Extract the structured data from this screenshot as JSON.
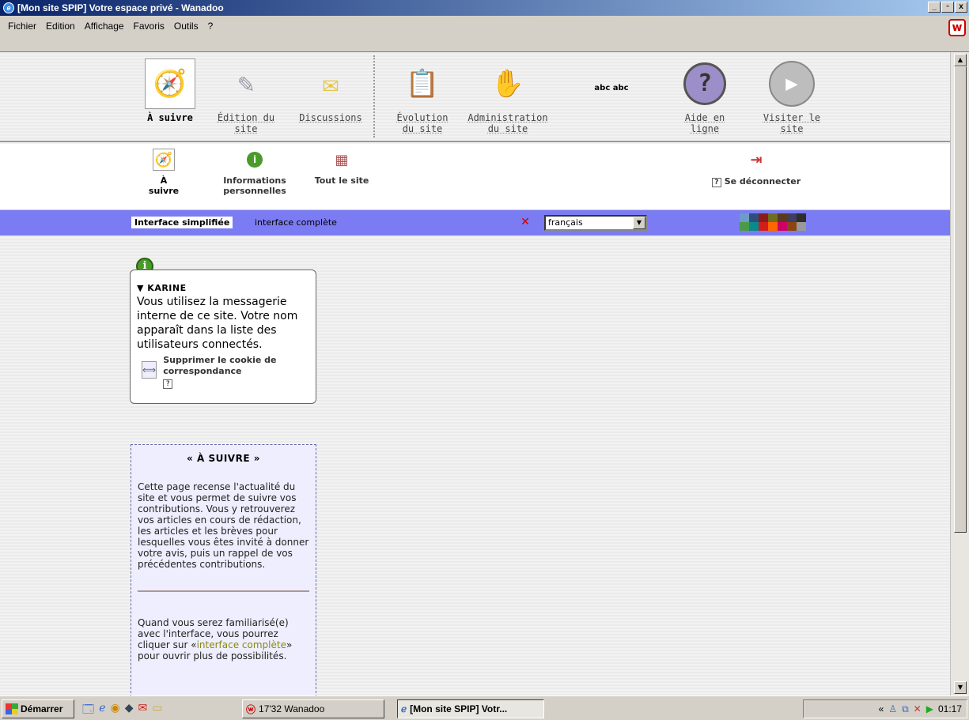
{
  "window": {
    "title": "[Mon site SPIP] Votre espace privé - Wanadoo",
    "controls": [
      "_",
      "▫",
      "x"
    ]
  },
  "menu": [
    "Fichier",
    "Edition",
    "Affichage",
    "Favoris",
    "Outils",
    "?"
  ],
  "topnav": [
    {
      "label": "À suivre",
      "icon": "compass-icon",
      "active": true
    },
    {
      "label": "Édition du site",
      "icon": "pens-icon"
    },
    {
      "label": "Discussions",
      "icon": "notes-icon"
    },
    {
      "label": "Évolution du site",
      "icon": "clipboard-icon"
    },
    {
      "label": "Administration du site",
      "icon": "admin-hand-icon"
    },
    {
      "label": "abc abc",
      "icon": "spelling-icon"
    },
    {
      "label": "Aide en ligne",
      "icon": "help-icon"
    },
    {
      "label": "Visiter le site",
      "icon": "play-icon"
    }
  ],
  "subnav": [
    {
      "label": "À suivre",
      "active": true
    },
    {
      "label": "Informations personnelles"
    },
    {
      "label": "Tout le site"
    },
    {
      "label": "Se déconnecter"
    }
  ],
  "interface": {
    "simple": "Interface simplifiée",
    "complete": "interface complète",
    "language": "français"
  },
  "swatches": [
    "#6e9cc9",
    "#2e4e7e",
    "#8b1c1c",
    "#6e6e1e",
    "#5a3a1e",
    "#3e3e5e",
    "#2e2e2e",
    "#4a9a4a",
    "#0a8a8a",
    "#d41c1c",
    "#ff6600",
    "#cc0066",
    "#8b4513",
    "#999999"
  ],
  "info": {
    "name": "KARINE",
    "message": "Vous utilisez la messagerie interne de ce site. Votre nom apparaît dans la liste des utilisateurs connectés.",
    "cookie_link": "Supprimer le cookie de correspondance",
    "help": "?"
  },
  "suivre": {
    "title": "« À SUIVRE »",
    "text1": "Cette page recense l'actualité du site et vous permet de suivre vos contributions. Vous y retrouverez vos articles en cours de rédaction, les articles et les brèves pour lesquelles vous êtes invité à donner votre avis, puis un rappel de vos précédentes contributions.",
    "text2_before": "Quand vous serez familiarisé(e) avec l'interface, vous pourrez cliquer sur «",
    "text2_link": "interface complète",
    "text2_after": "» pour ouvrir plus de possibilités."
  },
  "taskbar": {
    "start": "Démarrer",
    "task1": "17'32 Wanadoo",
    "task2": "[Mon site SPIP] Votr...",
    "clock": "01:17"
  }
}
